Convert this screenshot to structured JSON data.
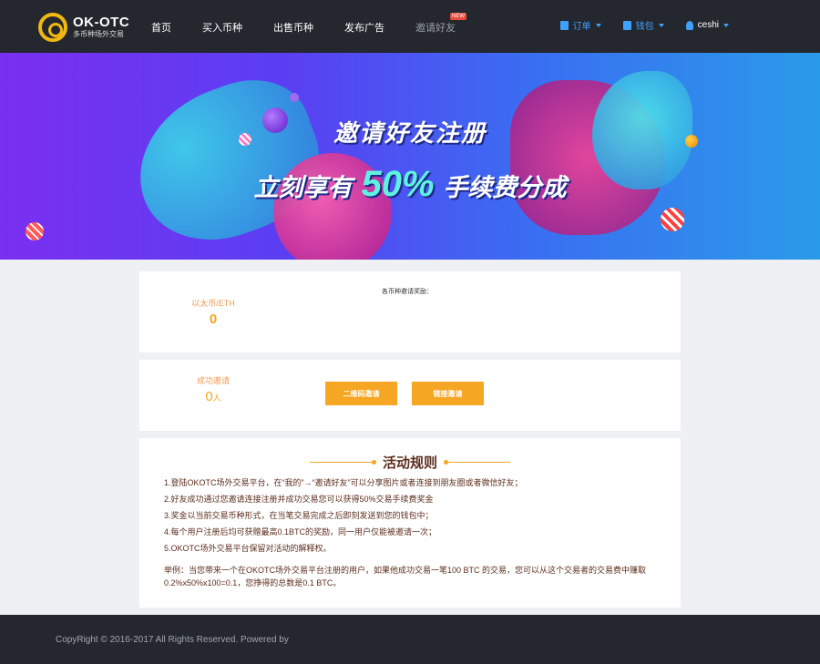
{
  "header": {
    "logo_title": "OK-OTC",
    "logo_subtitle": "多币种场外交易",
    "nav": [
      {
        "label": "首页"
      },
      {
        "label": "买入币种"
      },
      {
        "label": "出售币种"
      },
      {
        "label": "发布广告"
      },
      {
        "label": "邀请好友",
        "badge": "NEW"
      }
    ],
    "right": {
      "orders": "订单",
      "wallet": "钱包",
      "user": "ceshi"
    }
  },
  "banner": {
    "line1": "邀请好友注册",
    "line2_prefix": "立刻享有",
    "line2_percent": "50%",
    "line2_suffix": "手续费分成"
  },
  "reward": {
    "currency_label": "以太币/ETH",
    "currency_value": "0",
    "reward_title": "各币种邀请奖励："
  },
  "invite": {
    "success_label": "成功邀请",
    "success_count": "0",
    "success_unit": "人",
    "qr_button": "二维码邀请",
    "link_button": "链接邀请"
  },
  "rules": {
    "title": "活动规则",
    "items": [
      "1.登陆OKOTC场外交易平台，在“我的”→“邀请好友”可以分享图片或者连接到朋友圈或者微信好友；",
      "2.好友成功通过您邀请连接注册并成功交易您可以获得50%交易手续费奖金",
      "3.奖金以当前交易币种形式，在当笔交易完成之后即刻发送到您的钱包中；",
      "4.每个用户注册后均可获赠最高0.1BTC的奖励，同一用户仅能被邀请一次；",
      "5.OKOTC场外交易平台保留对活动的解释权。"
    ],
    "example": "举例：当您带来一个在OKOTC场外交易平台注册的用户，如果他成功交易一笔100 BTC 的交易，您可以从这个交易者的交易费中赚取0.2%x50%x100=0.1，您挣得的总数是0.1 BTC。"
  },
  "footer": {
    "copyright": "CopyRight © 2016-2017 All Rights Reserved. Powered by"
  }
}
